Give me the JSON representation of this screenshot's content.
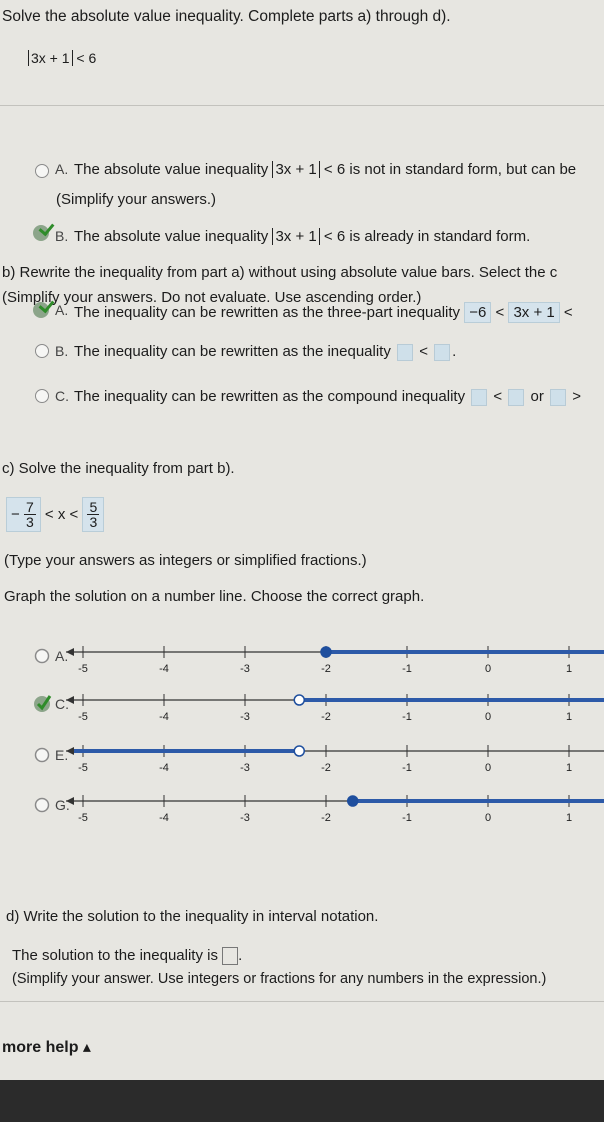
{
  "header": {
    "instruction": "Solve the absolute value inequality. Complete parts a) through d).",
    "inequality_inner": "3x + 1",
    "inequality_rhs": "< 6"
  },
  "part_a": {
    "option_a_letter": "A.",
    "option_a_text_before": "The absolute value inequality",
    "option_a_inner": "3x + 1",
    "option_a_text_after": "< 6 is not in standard form, but can be",
    "simplify_note": "(Simplify your answers.)",
    "option_b_letter": "B.",
    "option_b_text_before": "The absolute value inequality",
    "option_b_inner": "3x + 1",
    "option_b_text_after": "< 6 is already in standard form."
  },
  "part_b": {
    "prompt": "b) Rewrite the inequality from part a) without using absolute value bars. Select the c",
    "note": "(Simplify your answers. Do not evaluate. Use ascending order.)",
    "option_a_letter": "A.",
    "option_a_text": "The inequality can be rewritten as the three-part inequality",
    "option_a_ans1": "−6",
    "option_a_lt1": "<",
    "option_a_ans2": "3x + 1",
    "option_a_lt2": "<",
    "option_b_letter": "B.",
    "option_b_text": "The inequality can be rewritten as the inequality",
    "option_b_lt": "<",
    "option_b_end": ".",
    "option_c_letter": "C.",
    "option_c_text": "The inequality can be rewritten as the compound inequality",
    "option_c_lt": "<",
    "option_c_or": "or",
    "option_c_gt": ">"
  },
  "part_c": {
    "prompt": "c) Solve the inequality from part b).",
    "answer_left_sign": "−",
    "answer_left_num": "7",
    "answer_left_den": "3",
    "answer_middle": "< x <",
    "answer_right_num": "5",
    "answer_right_den": "3",
    "type_note": "(Type your answers as integers or simplified fractions.)",
    "graph_prompt": "Graph the solution on a number line. Choose the correct graph."
  },
  "graphs": {
    "ticks": [
      "-5",
      "-4",
      "-3",
      "-2",
      "-1",
      "0",
      "1"
    ],
    "options": [
      {
        "letter": "A.",
        "selected": false,
        "shade": "right",
        "point_value": -2.0,
        "point_open": false
      },
      {
        "letter": "C.",
        "selected": true,
        "shade": "right",
        "point_value": -2.33,
        "point_open": true
      },
      {
        "letter": "E.",
        "selected": false,
        "shade": "left",
        "point_value": -2.33,
        "point_open": true
      },
      {
        "letter": "G.",
        "selected": false,
        "shade": "right",
        "point_value": -1.67,
        "point_open": false
      }
    ],
    "line_color": "#2d5aa8",
    "point_color": "#1f4f9e"
  },
  "part_d": {
    "prompt": "d) Write the solution to the inequality in interval notation.",
    "solution_text": "The solution to the inequality is",
    "solution_end": ".",
    "note": "(Simplify your answer. Use integers or fractions for any numbers in the expression.)"
  },
  "footer": {
    "more_help": "more help ▴"
  }
}
